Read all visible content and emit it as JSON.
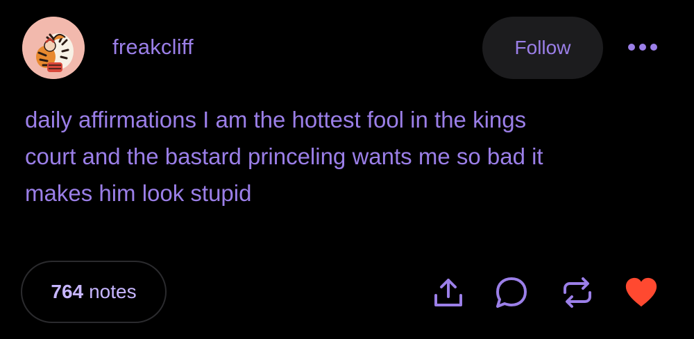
{
  "post": {
    "username": "freakcliff",
    "follow_label": "Follow",
    "body_lines": [
      "daily affirmations I am the hottest fool in the kings",
      "court and the bastard princeling wants me so bad it",
      "makes him look stupid"
    ],
    "notes": {
      "count": "764",
      "label": "notes"
    }
  },
  "icons": {
    "avatar": "avatar-image",
    "more": "more-horizontal-icon",
    "share": "share-icon",
    "reply": "reply-bubble-icon",
    "reblog": "reblog-icon",
    "like": "heart-icon"
  },
  "colors": {
    "background": "#000000",
    "accent": "#9b7fe8",
    "follow_bg": "#1c1c1e",
    "heart": "#ff4930"
  }
}
